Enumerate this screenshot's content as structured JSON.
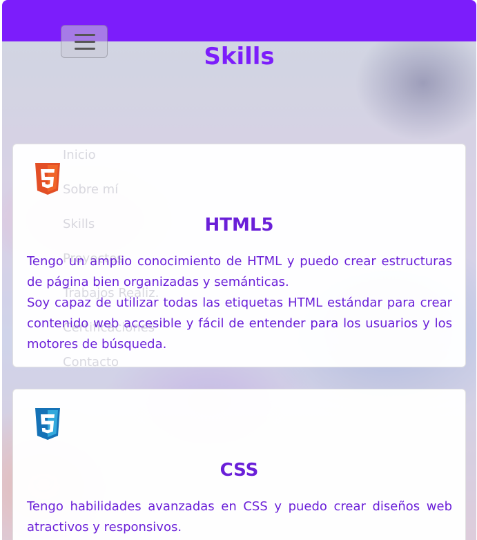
{
  "page": {
    "title": "Skills"
  },
  "nav": {
    "items": [
      "Inicio",
      "Sobre mí",
      "Skills",
      "Proyectos",
      "Trabajos Realiz.",
      "Certificaciones",
      "Contacto"
    ]
  },
  "cards": [
    {
      "icon": "html5-icon",
      "title": "HTML5",
      "paragraphs": [
        "Tengo un amplio conocimiento de HTML y puedo crear estructuras de página bien organizadas y semánticas.",
        "Soy capaz de utilizar todas las etiquetas HTML estándar para crear contenido web accesible y fácil de entender para los usuarios y los motores de búsqueda."
      ]
    },
    {
      "icon": "css3-icon",
      "title": "CSS",
      "paragraphs": [
        "Tengo habilidades avanzadas en CSS y puedo crear diseños web atractivos y responsivos."
      ]
    }
  ],
  "colors": {
    "accent": "#7c1dfb",
    "text": "#6a1fd8",
    "html5_orange": "#e34f26",
    "css3_blue": "#1572b6"
  }
}
